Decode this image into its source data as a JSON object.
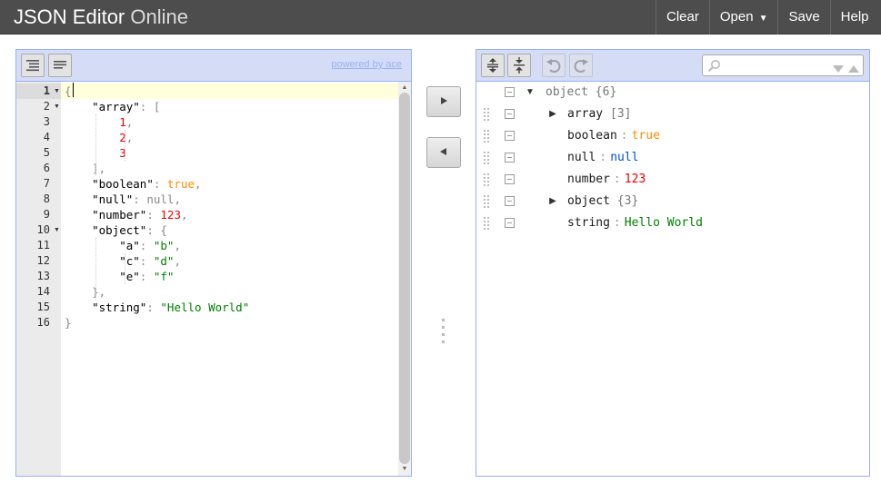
{
  "header": {
    "brand_bold": "JSON Editor",
    "brand_thin": "Online",
    "menu": {
      "clear": "Clear",
      "open": "Open",
      "open_caret": "▼",
      "save": "Save",
      "help": "Help"
    },
    "background": "#4d4d4d"
  },
  "code_editor": {
    "toolbar": {
      "format_icon": "format-icon",
      "compact_icon": "compact-icon",
      "powered_by": "powered by ace"
    },
    "active_line": 1,
    "line_numbers": [
      "1",
      "2",
      "3",
      "4",
      "5",
      "6",
      "7",
      "8",
      "9",
      "10",
      "11",
      "12",
      "13",
      "14",
      "15",
      "16"
    ],
    "foldable_lines": [
      1,
      2,
      10
    ],
    "lines": [
      [
        {
          "t": "{",
          "c": "punc"
        }
      ],
      [
        {
          "t": "    ",
          "c": "key"
        },
        {
          "t": "\"array\"",
          "c": "key"
        },
        {
          "t": ": [",
          "c": "punc"
        }
      ],
      [
        {
          "t": "        ",
          "c": "key"
        },
        {
          "t": "1",
          "c": "num"
        },
        {
          "t": ",",
          "c": "punc"
        }
      ],
      [
        {
          "t": "        ",
          "c": "key"
        },
        {
          "t": "2",
          "c": "num"
        },
        {
          "t": ",",
          "c": "punc"
        }
      ],
      [
        {
          "t": "        ",
          "c": "key"
        },
        {
          "t": "3",
          "c": "num"
        }
      ],
      [
        {
          "t": "    ",
          "c": "key"
        },
        {
          "t": "],",
          "c": "punc"
        }
      ],
      [
        {
          "t": "    ",
          "c": "key"
        },
        {
          "t": "\"boolean\"",
          "c": "key"
        },
        {
          "t": ": ",
          "c": "punc"
        },
        {
          "t": "true",
          "c": "bool"
        },
        {
          "t": ",",
          "c": "punc"
        }
      ],
      [
        {
          "t": "    ",
          "c": "key"
        },
        {
          "t": "\"null\"",
          "c": "key"
        },
        {
          "t": ": ",
          "c": "punc"
        },
        {
          "t": "null",
          "c": "null"
        },
        {
          "t": ",",
          "c": "punc"
        }
      ],
      [
        {
          "t": "    ",
          "c": "key"
        },
        {
          "t": "\"number\"",
          "c": "key"
        },
        {
          "t": ": ",
          "c": "punc"
        },
        {
          "t": "123",
          "c": "num"
        },
        {
          "t": ",",
          "c": "punc"
        }
      ],
      [
        {
          "t": "    ",
          "c": "key"
        },
        {
          "t": "\"object\"",
          "c": "key"
        },
        {
          "t": ": {",
          "c": "punc"
        }
      ],
      [
        {
          "t": "        ",
          "c": "key"
        },
        {
          "t": "\"a\"",
          "c": "key"
        },
        {
          "t": ": ",
          "c": "punc"
        },
        {
          "t": "\"b\"",
          "c": "str"
        },
        {
          "t": ",",
          "c": "punc"
        }
      ],
      [
        {
          "t": "        ",
          "c": "key"
        },
        {
          "t": "\"c\"",
          "c": "key"
        },
        {
          "t": ": ",
          "c": "punc"
        },
        {
          "t": "\"d\"",
          "c": "str"
        },
        {
          "t": ",",
          "c": "punc"
        }
      ],
      [
        {
          "t": "        ",
          "c": "key"
        },
        {
          "t": "\"e\"",
          "c": "key"
        },
        {
          "t": ": ",
          "c": "punc"
        },
        {
          "t": "\"f\"",
          "c": "str"
        }
      ],
      [
        {
          "t": "    ",
          "c": "key"
        },
        {
          "t": "},",
          "c": "punc"
        }
      ],
      [
        {
          "t": "    ",
          "c": "key"
        },
        {
          "t": "\"string\"",
          "c": "key"
        },
        {
          "t": ": ",
          "c": "punc"
        },
        {
          "t": "\"Hello World\"",
          "c": "str"
        }
      ],
      [
        {
          "t": "}",
          "c": "punc"
        }
      ]
    ]
  },
  "middle": {
    "copy_right_icon": "arrow-right-icon",
    "copy_left_icon": "arrow-left-icon"
  },
  "tree_editor": {
    "toolbar": {
      "expand_all_icon": "expand-all-icon",
      "collapse_all_icon": "collapse-all-icon",
      "undo_icon": "undo-icon",
      "redo_icon": "redo-icon",
      "search_placeholder": "",
      "search_icon": "search-icon"
    },
    "root": {
      "field": "object",
      "count": "{6}",
      "expander": "▼"
    },
    "nodes": [
      {
        "field": "array",
        "expander": "▶",
        "value": "[3]",
        "kind": "count"
      },
      {
        "field": "boolean",
        "expander": "",
        "value": "true",
        "kind": "bool"
      },
      {
        "field": "null",
        "expander": "",
        "value": "null",
        "kind": "null"
      },
      {
        "field": "number",
        "expander": "",
        "value": "123",
        "kind": "num"
      },
      {
        "field": "object",
        "expander": "▶",
        "value": "{3}",
        "kind": "count"
      },
      {
        "field": "string",
        "expander": "",
        "value": "Hello World",
        "kind": "str"
      }
    ],
    "separator": ":"
  },
  "colors": {
    "accent_border": "#97b0f8",
    "toolbar_bg": "#d5ddf6",
    "string": "#008000",
    "number": "#ee0000",
    "boolean": "#ff8c00",
    "null": "#004ed0"
  }
}
